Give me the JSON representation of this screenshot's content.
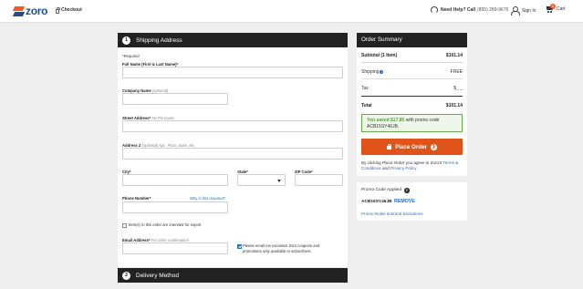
{
  "header": {
    "logo_text": "zoro",
    "checkout_label": "Checkout",
    "help_label": "Need Help? Call",
    "help_phone": "(855) 289-9676",
    "signin_label": "Sign In",
    "cart_label": "Cart",
    "cart_count": "1"
  },
  "shipping": {
    "step": "1",
    "title": "Shipping Address",
    "required_note": "*Required",
    "full_name_label": "Full Name (First & Last Name)*",
    "company_label": "Company Name",
    "company_hint": "(optional)",
    "street_label": "Street Address*",
    "street_hint": "No PO boxes",
    "address2_label": "Address 2",
    "address2_hint": "(optional) Apt., Floor, Suite, etc.",
    "city_label": "City*",
    "state_label": "State*",
    "zip_label": "ZIP Code*",
    "phone_label": "Phone Number*",
    "phone_why": "Why is this required?",
    "export_label": "Item(s) in this order are intended for export",
    "email_label": "Email Address*",
    "email_hint": "For order confirmation",
    "promo_optin_line1": "Please email me exclusive Zoro coupons and",
    "promo_optin_line2": "promotions only available to subscribers."
  },
  "delivery": {
    "step": "2",
    "title": "Delivery Method"
  },
  "summary": {
    "title": "Order Summary",
    "subtotal_label": "Subtotal (1 Item)",
    "subtotal_value": "$101.14",
    "shipping_label": "Shipping",
    "shipping_value": "FREE",
    "tax_label": "Tax",
    "tax_value": "$_ _",
    "total_label": "Total",
    "total_value": "$101.14",
    "saved_prefix": "You saved",
    "saved_amount": "$17.85",
    "saved_mid": "with promo code",
    "saved_code": "ACB15SY46JB.",
    "place_order": "Place Order",
    "terms_1": "By clicking Place Order you agree to Zoro's",
    "terms_link1": "Terms & Conditions",
    "terms_and": "and",
    "terms_link2": "Privacy Policy"
  },
  "promo": {
    "title": "Promo Code Applied",
    "code": "ACB15SY46JB",
    "remove": "REMOVE",
    "rules": "Promo Rules & Brand Exclusions"
  }
}
